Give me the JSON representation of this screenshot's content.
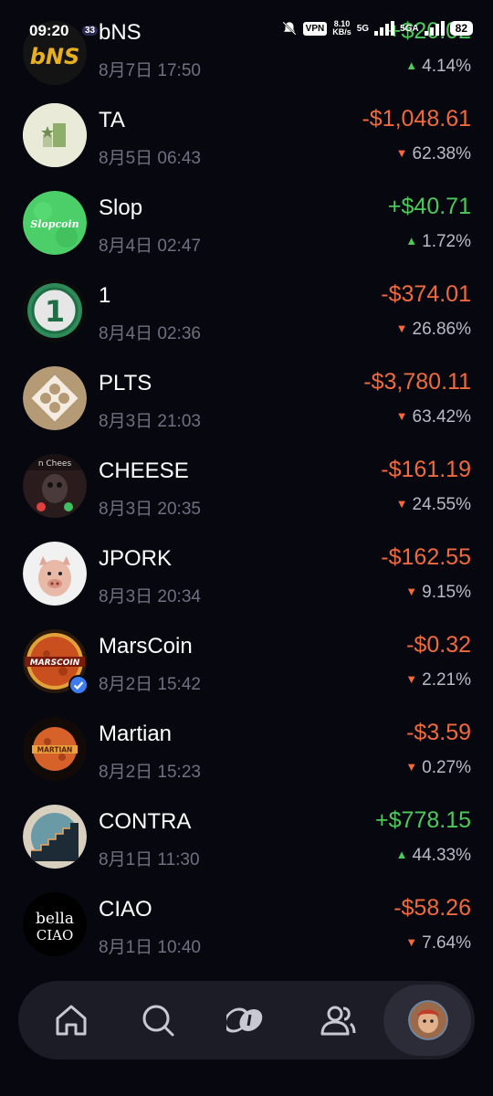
{
  "status_bar": {
    "time": "09:20",
    "mini_badge": "33",
    "vpn": "VPN",
    "speed_value": "8.10",
    "speed_unit": "KB/s",
    "network": "5G",
    "network2": "5GA",
    "battery": "82"
  },
  "holdings": [
    {
      "name": "bNS",
      "date": "8月7日 17:50",
      "pnl": "+$20.02",
      "pct": "4.14%",
      "trend": "up"
    },
    {
      "name": "TA",
      "date": "8月5日 06:43",
      "pnl": "-$1,048.61",
      "pct": "62.38%",
      "trend": "down"
    },
    {
      "name": "Slop",
      "date": "8月4日 02:47",
      "pnl": "+$40.71",
      "pct": "1.72%",
      "trend": "up"
    },
    {
      "name": "1",
      "date": "8月4日 02:36",
      "pnl": "-$374.01",
      "pct": "26.86%",
      "trend": "down"
    },
    {
      "name": "PLTS",
      "date": "8月3日 21:03",
      "pnl": "-$3,780.11",
      "pct": "63.42%",
      "trend": "down"
    },
    {
      "name": "CHEESE",
      "date": "8月3日 20:35",
      "pnl": "-$161.19",
      "pct": "24.55%",
      "trend": "down"
    },
    {
      "name": "JPORK",
      "date": "8月3日 20:34",
      "pnl": "-$162.55",
      "pct": "9.15%",
      "trend": "down"
    },
    {
      "name": "MarsCoin",
      "date": "8月2日 15:42",
      "pnl": "-$0.32",
      "pct": "2.21%",
      "trend": "down"
    },
    {
      "name": "Martian",
      "date": "8月2日 15:23",
      "pnl": "-$3.59",
      "pct": "0.27%",
      "trend": "down"
    },
    {
      "name": "CONTRA",
      "date": "8月1日 11:30",
      "pnl": "+$778.15",
      "pct": "44.33%",
      "trend": "up"
    },
    {
      "name": "CIAO",
      "date": "8月1日 10:40",
      "pnl": "-$58.26",
      "pct": "7.64%",
      "trend": "down"
    }
  ],
  "logo_text": {
    "bns": "bNS",
    "slop": "Slopcoin",
    "one": "1",
    "cheese": "n Chees",
    "marscoin": "MARSCOIN",
    "martian": "MARTIAN",
    "ciao_top": "bella",
    "ciao_bottom": "CIAO"
  },
  "icons": {
    "home": "home-icon",
    "search": "search-icon",
    "coins": "coins-icon",
    "community": "users-icon",
    "profile": "profile-avatar"
  },
  "colors": {
    "up": "#4cc95a",
    "down": "#f06a3e",
    "background": "#07070f",
    "muted": "#6f7080"
  }
}
